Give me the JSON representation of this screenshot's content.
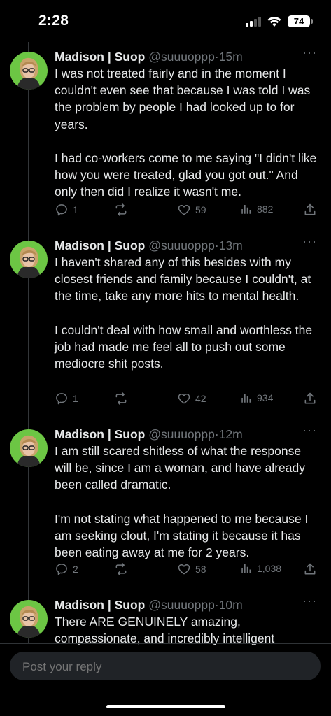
{
  "status_bar": {
    "time": "2:28",
    "battery": "74",
    "signal_icon": "cellular-signal-icon",
    "wifi_icon": "wifi-icon"
  },
  "tweets": [
    {
      "name": "Madison | Suop",
      "handle": "@suuuoppp",
      "separator": "·",
      "time": "15m",
      "more": "···",
      "paragraphs": [
        "I was not treated fairly and in the moment I couldn't even see that because I was told I was the problem by people I had looked up to for years.",
        "I had co-workers come to me saying \"I didn't like how you were treated, glad you got out.\" And only then did I realize it wasn't me."
      ],
      "replies": "1",
      "retweets": "",
      "likes": "59",
      "views": "882"
    },
    {
      "name": "Madison | Suop",
      "handle": "@suuuoppp",
      "separator": "·",
      "time": "13m",
      "more": "···",
      "paragraphs": [
        "I haven't shared any of this besides with my closest friends and family because I couldn't, at the time, take any more hits to mental health.",
        "I couldn't deal with how small and worthless the job had made me feel all to push out some mediocre shit posts."
      ],
      "replies": "1",
      "retweets": "",
      "likes": "42",
      "views": "934"
    },
    {
      "name": "Madison | Suop",
      "handle": "@suuuoppp",
      "separator": "·",
      "time": "12m",
      "more": "···",
      "paragraphs": [
        "I am still scared shitless of what the response will be, since I am a woman, and have already been called dramatic.",
        "I'm not stating what happened to me because I am seeking clout, I'm stating it because it has been eating away at me for 2 years."
      ],
      "replies": "2",
      "retweets": "",
      "likes": "58",
      "views": "1,038"
    },
    {
      "name": "Madison | Suop",
      "handle": "@suuuoppp",
      "separator": "·",
      "time": "10m",
      "more": "···",
      "paragraphs": [
        "There ARE GENUINELY amazing, compassionate, and incredibly intelligent"
      ]
    }
  ],
  "reply_bar": {
    "placeholder": "Post your reply"
  },
  "colors": {
    "background": "#000000",
    "text": "#e7e9ea",
    "muted": "#71767b",
    "avatar_bg": "#6cc644"
  }
}
